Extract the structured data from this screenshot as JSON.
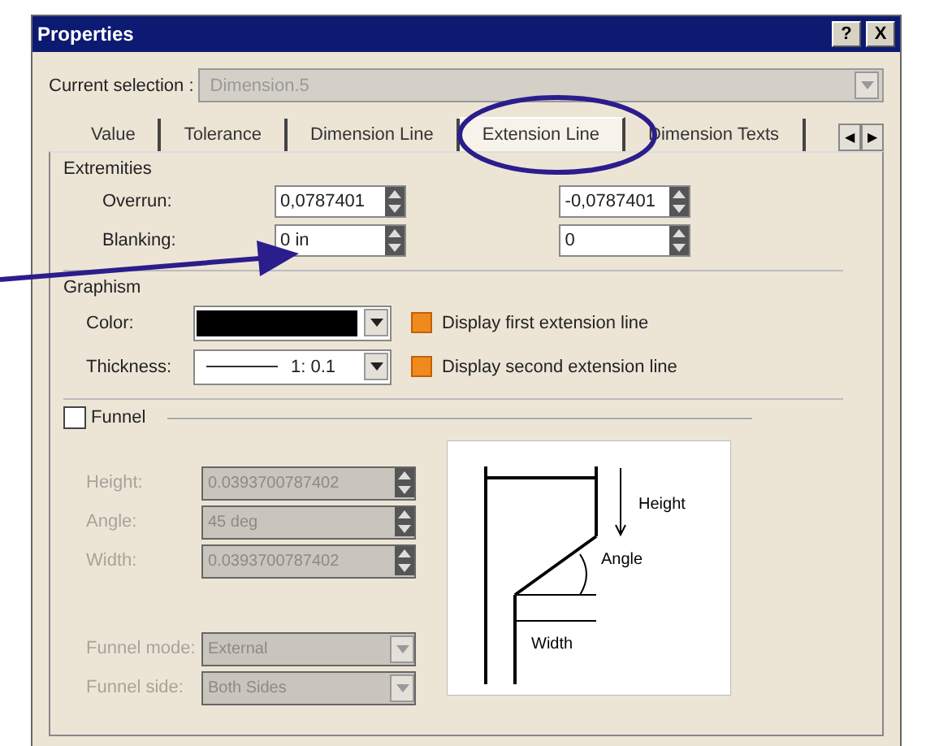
{
  "window": {
    "title": "Properties",
    "buttons": [
      "?",
      "X"
    ]
  },
  "current_selection": {
    "label": "Current selection :",
    "value": "Dimension.5"
  },
  "tabs": [
    {
      "label": "Value",
      "selected": false
    },
    {
      "label": "Tolerance",
      "selected": false
    },
    {
      "label": "Dimension Line",
      "selected": false
    },
    {
      "label": "Extension Line",
      "selected": true
    },
    {
      "label": "Dimension Texts",
      "selected": false
    }
  ],
  "tab_scroll": [
    "◀",
    "▶"
  ],
  "extremities": {
    "title": "Extremities",
    "rows": [
      {
        "label": "Overrun:",
        "values": [
          "0,0787401",
          "-0,0787401"
        ]
      },
      {
        "label": "Blanking:",
        "values": [
          "0 in",
          "0"
        ]
      }
    ]
  },
  "graphism": {
    "title": "Graphism",
    "color_label": "Color:",
    "thickness_label": "Thickness:",
    "thickness_value": "1: 0.1",
    "options": [
      {
        "label": "Display first extension line",
        "checked": true
      },
      {
        "label": "Display second extension line",
        "checked": true
      }
    ]
  },
  "funnel": {
    "label": "Funnel",
    "checked": false,
    "fields": [
      {
        "label": "Height:",
        "value": "0.0393700787402",
        "kind": "spin"
      },
      {
        "label": "Angle:",
        "value": "45 deg",
        "kind": "spin"
      },
      {
        "label": "Width:",
        "value": "0.0393700787402",
        "kind": "spin"
      },
      {
        "label": "Funnel mode:",
        "value": "External",
        "kind": "combo"
      },
      {
        "label": "Funnel side:",
        "value": "Both Sides",
        "kind": "combo"
      }
    ],
    "diagram_labels": [
      "Height",
      "Angle",
      "Width"
    ]
  }
}
